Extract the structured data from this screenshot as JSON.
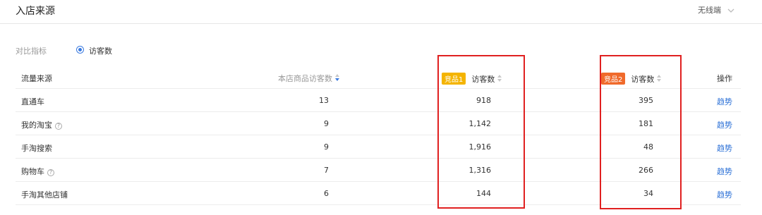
{
  "header": {
    "title": "入店来源",
    "device": "无线端",
    "device_icon": "chevron-down-icon"
  },
  "filter": {
    "label": "对比指标",
    "option": "访客数"
  },
  "table": {
    "headers": {
      "source": "流量来源",
      "own_visitors": "本店商品访客数",
      "comp1_badge": "竞品1",
      "comp1_visitors": "访客数",
      "comp2_badge": "竞品2",
      "comp2_visitors": "访客数",
      "action": "操作"
    },
    "rows": [
      {
        "source": "直通车",
        "own": "13",
        "comp1": "918",
        "comp2": "395",
        "action": "趋势",
        "help": false
      },
      {
        "source": "我的淘宝",
        "own": "9",
        "comp1": "1,142",
        "comp2": "181",
        "action": "趋势",
        "help": true
      },
      {
        "source": "手淘搜索",
        "own": "9",
        "comp1": "1,916",
        "comp2": "48",
        "action": "趋势",
        "help": false
      },
      {
        "source": "购物车",
        "own": "7",
        "comp1": "1,316",
        "comp2": "266",
        "action": "趋势",
        "help": true
      },
      {
        "source": "手淘其他店铺",
        "own": "6",
        "comp1": "144",
        "comp2": "34",
        "action": "趋势",
        "help": false
      }
    ]
  },
  "colors": {
    "accent": "#3b7be0",
    "badge1": "#f4b400",
    "badge2": "#f06a2b",
    "highlight_box": "#e02020",
    "link": "#2a6fd6"
  }
}
